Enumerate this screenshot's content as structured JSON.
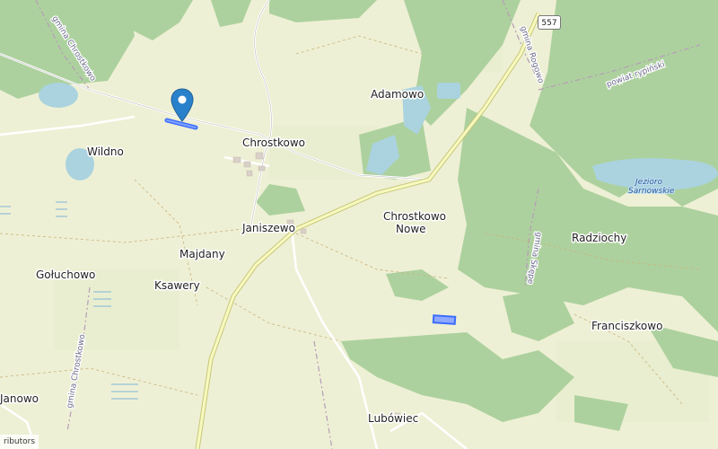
{
  "map": {
    "places": [
      {
        "name": "Adamowo"
      },
      {
        "name": "Wildno"
      },
      {
        "name": "Chrostkowo"
      },
      {
        "name": "Janiszewo"
      },
      {
        "name": "Chrostkowo"
      },
      {
        "name": "Nowe"
      },
      {
        "name": "Radziochy"
      },
      {
        "name": "Majdany"
      },
      {
        "name": "Gołuchowo"
      },
      {
        "name": "Ksawery"
      },
      {
        "name": "Franciszkowo"
      },
      {
        "name": "Janowo"
      },
      {
        "name": "Lubówiec"
      }
    ],
    "admin_labels": [
      "gmina Chrostkowo",
      "gmina Rogowo",
      "gmina Skępe",
      "gmina Chrostkowo",
      "powiat rypiński"
    ],
    "lake_label_line1": "Jezioro",
    "lake_label_line2": "Sarnowskie",
    "road_shield": "557",
    "attribution": "ributors",
    "marker_icon": "map-pin-icon",
    "colors": {
      "background": "#eef0d5",
      "forest": "#add19e",
      "water": "#aad3df",
      "road_primary": "#f7fabf",
      "marker": "#2a81cb",
      "highlight": "#3b6dff"
    }
  }
}
